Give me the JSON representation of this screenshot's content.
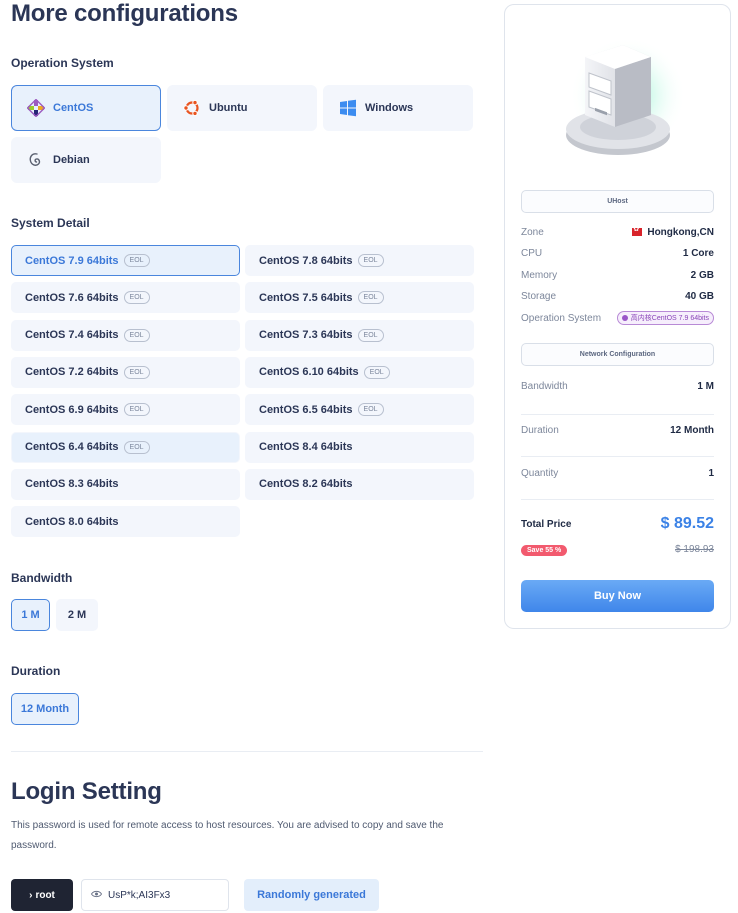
{
  "title": "More configurations",
  "os_section": {
    "label": "Operation System",
    "options": [
      {
        "name": "CentOS",
        "icon": "centos-icon",
        "selected": true
      },
      {
        "name": "Ubuntu",
        "icon": "ubuntu-icon",
        "selected": false
      },
      {
        "name": "Windows",
        "icon": "windows-icon",
        "selected": false
      },
      {
        "name": "Debian",
        "icon": "debian-icon",
        "selected": false
      }
    ]
  },
  "system_detail": {
    "label": "System Detail",
    "eol_label": "EOL",
    "versions": [
      {
        "name": "CentOS 7.9 64bits",
        "eol": true
      },
      {
        "name": "CentOS 7.8 64bits",
        "eol": true
      },
      {
        "name": "CentOS 7.6 64bits",
        "eol": true
      },
      {
        "name": "CentOS 7.5 64bits",
        "eol": true
      },
      {
        "name": "CentOS 7.4 64bits",
        "eol": true
      },
      {
        "name": "CentOS 7.3 64bits",
        "eol": true
      },
      {
        "name": "CentOS 7.2 64bits",
        "eol": true
      },
      {
        "name": "CentOS 6.10 64bits",
        "eol": true
      },
      {
        "name": "CentOS 6.9 64bits",
        "eol": true
      },
      {
        "name": "CentOS 6.5 64bits",
        "eol": true
      },
      {
        "name": "CentOS 6.4 64bits",
        "eol": true
      },
      {
        "name": "CentOS 8.4 64bits",
        "eol": false
      },
      {
        "name": "CentOS 8.3 64bits",
        "eol": false
      },
      {
        "name": "CentOS 8.2 64bits",
        "eol": false
      },
      {
        "name": "CentOS 8.0 64bits",
        "eol": false
      }
    ]
  },
  "bandwidth": {
    "label": "Bandwidth",
    "options": [
      "1 M",
      "2 M"
    ]
  },
  "duration": {
    "label": "Duration",
    "options": [
      "12 Month"
    ]
  },
  "login": {
    "title": "Login Setting",
    "description": "This password is used for remote access to host resources. You are advised to copy and save the password.",
    "user_button": "root",
    "password_value": "UsP*k;AI3Fx3",
    "random_button": "Randomly generated"
  },
  "summary": {
    "product": "UHost",
    "zone_label": "Zone",
    "zone_value": "Hongkong,CN",
    "cpu_label": "CPU",
    "cpu_value": "1 Core",
    "memory_label": "Memory",
    "memory_value": "2 GB",
    "storage_label": "Storage",
    "storage_value": "40 GB",
    "os_label": "Operation System",
    "os_value": "高内核CentOS 7.9 64bits",
    "network_title": "Network Configuration",
    "bandwidth_label": "Bandwidth",
    "bandwidth_value": "1 M",
    "duration_label": "Duration",
    "duration_value": "12 Month",
    "quantity_label": "Quantity",
    "quantity_value": "1",
    "total_label": "Total Price",
    "total_value": "$ 89.52",
    "save_badge": "Save 55 %",
    "original_price": "$ 198.93",
    "buy_button": "Buy Now"
  },
  "colors": {
    "accent": "#3b78d8",
    "primary_button": "#3f86ea",
    "dark_button": "#1f2433",
    "save_badge": "#f25a6e"
  }
}
